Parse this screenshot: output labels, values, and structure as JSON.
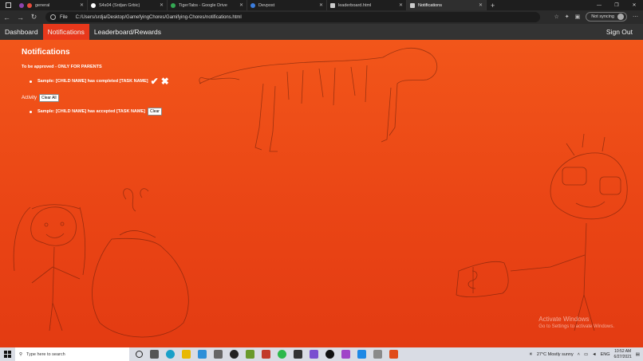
{
  "browser": {
    "tabs": [
      {
        "label": "general",
        "color": "#e74c3c"
      },
      {
        "label": "S4s04 (Srdjan Grbic)",
        "color": "#ffffff"
      },
      {
        "label": "TigerTabs - Google Drive",
        "color": "#34a853"
      },
      {
        "label": "Devpost",
        "color": "#3b7ddd"
      },
      {
        "label": "leaderboard.html",
        "color": "#cccccc"
      },
      {
        "label": "Notifications",
        "color": "#cccccc"
      }
    ],
    "url_scheme": "File",
    "url": "C:/Users/srdja/Desktop/GamefyingChores/Gamifying-Chores/notifications.html",
    "sync_label": "Not syncing"
  },
  "nav": {
    "dashboard": "Dashboard",
    "notifications": "Notifications",
    "leaderboard": "Leaderboard/Rewards",
    "signout": "Sign Out"
  },
  "page": {
    "title": "Notifications",
    "approve_label": "To be approved - ONLY FOR PARENTS",
    "pending": [
      {
        "text": "Sample: [CHILD NAME] has completed [TASK NAME]",
        "approve_icon": "✔",
        "reject_icon": "✖"
      }
    ],
    "activity_label": "Activity",
    "clear_all": "Clear All",
    "activity": [
      {
        "text": "Sample: [CHILD NAME] has accepted [TASK NAME]",
        "clear": "Clear"
      }
    ]
  },
  "watermark": {
    "line1": "Activate Windows",
    "line2": "Go to Settings to activate Windows."
  },
  "taskbar": {
    "search_placeholder": "Type here to search",
    "weather": "27°C  Mostly sunny",
    "lang": "ENG",
    "time": "10:52 AM",
    "date": "6/27/2021"
  },
  "colors": {
    "accent": "#e8381b",
    "background_top": "#f2561a",
    "background_bottom": "#e33b12",
    "navbar": "#333333"
  }
}
